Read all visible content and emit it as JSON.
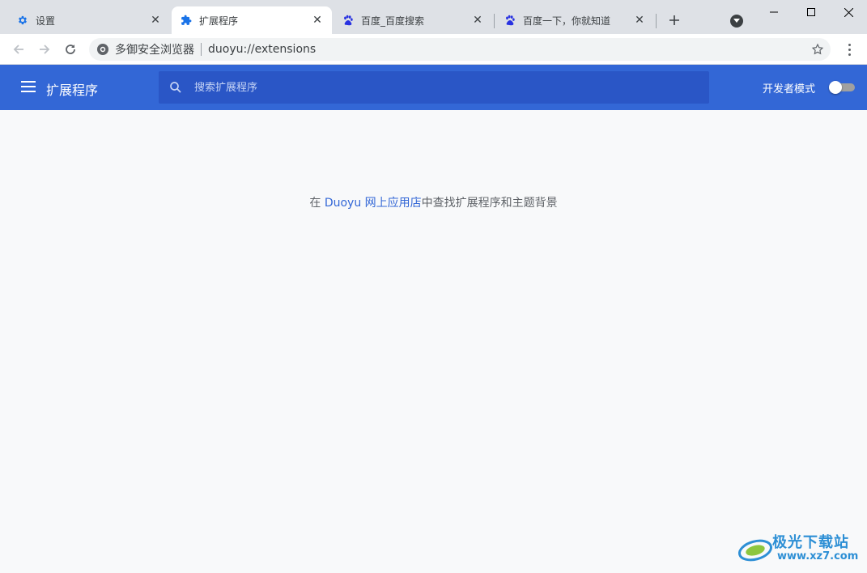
{
  "tabs": [
    {
      "title": "设置",
      "icon": "gear-icon"
    },
    {
      "title": "扩展程序",
      "icon": "puzzle-icon",
      "active": true
    },
    {
      "title": "百度_百度搜索",
      "icon": "baidu-paw-icon"
    },
    {
      "title": "百度一下，你就知道",
      "icon": "baidu-paw-icon"
    }
  ],
  "omnibox": {
    "brand": "多御安全浏览器",
    "url": "duoyu://extensions"
  },
  "header": {
    "title": "扩展程序",
    "search_placeholder": "搜索扩展程序",
    "dev_mode_label": "开发者模式",
    "dev_mode_on": false
  },
  "content": {
    "prefix": "在 ",
    "link": "Duoyu 网上应用店",
    "suffix": "中查找扩展程序和主题背景"
  },
  "watermark": {
    "line1": "极光下载站",
    "line2": "www.xz7.com"
  },
  "colors": {
    "accent": "#3367d6",
    "search_bg": "#2a56c6",
    "tabstrip": "#dee1e6",
    "page_bg": "#f8f9fa"
  }
}
